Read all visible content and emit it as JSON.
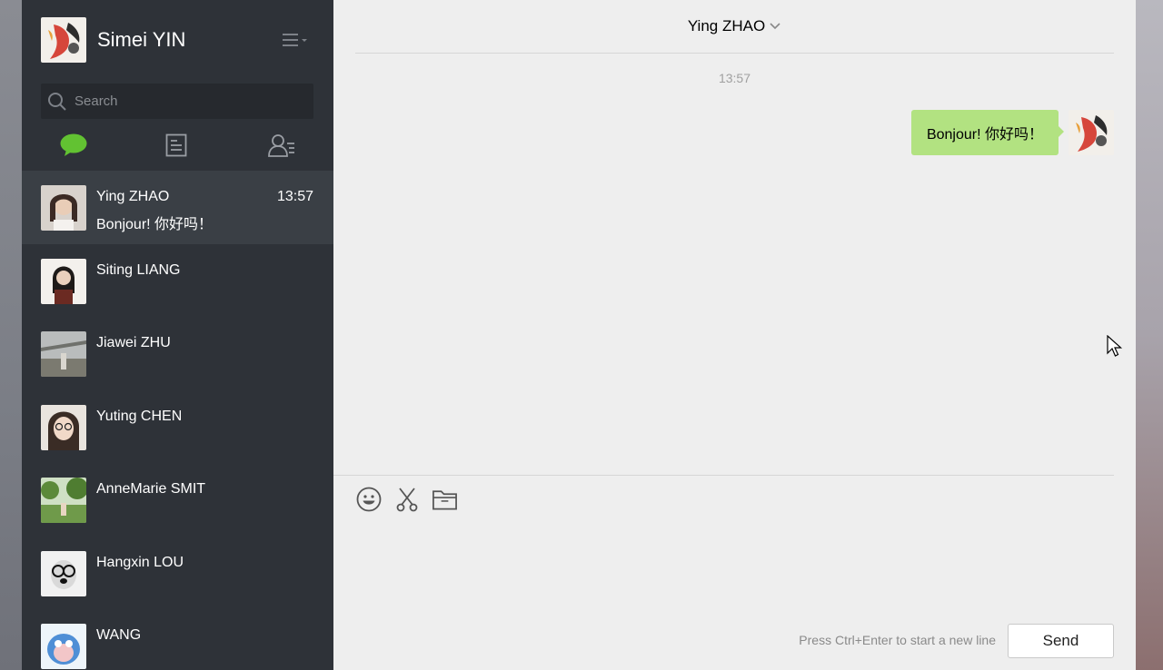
{
  "user": {
    "name": "Simei YIN",
    "avatar_icon": "koi-fish-avatar"
  },
  "search": {
    "placeholder": "Search"
  },
  "tabs": [
    {
      "icon": "chat-bubble-icon",
      "active": true
    },
    {
      "icon": "document-list-icon",
      "active": false
    },
    {
      "icon": "contacts-icon",
      "active": false
    }
  ],
  "chats": [
    {
      "name": "Ying ZHAO",
      "time": "13:57",
      "message": "Bonjour! 你好吗！",
      "active": true
    },
    {
      "name": "Siting LIANG",
      "time": "",
      "message": ""
    },
    {
      "name": "Jiawei ZHU",
      "time": "",
      "message": ""
    },
    {
      "name": "Yuting CHEN",
      "time": "",
      "message": ""
    },
    {
      "name": "AnneMarie SMIT",
      "time": "",
      "message": ""
    },
    {
      "name": "Hangxin LOU",
      "time": "",
      "message": ""
    },
    {
      "name": "WANG",
      "time": "",
      "message": ""
    }
  ],
  "conversation": {
    "title": "Ying ZHAO",
    "timestamp": "13:57",
    "messages": [
      {
        "text": "Bonjour! 你好吗！",
        "from": "me"
      }
    ]
  },
  "composer": {
    "hint": "Press Ctrl+Enter to start a new line",
    "send_label": "Send"
  },
  "colors": {
    "sidebar": "#2e3238",
    "active_row": "#3a3f45",
    "bubble": "#b2e281",
    "accent": "#62c232",
    "chat_bg": "#eeeeee"
  }
}
